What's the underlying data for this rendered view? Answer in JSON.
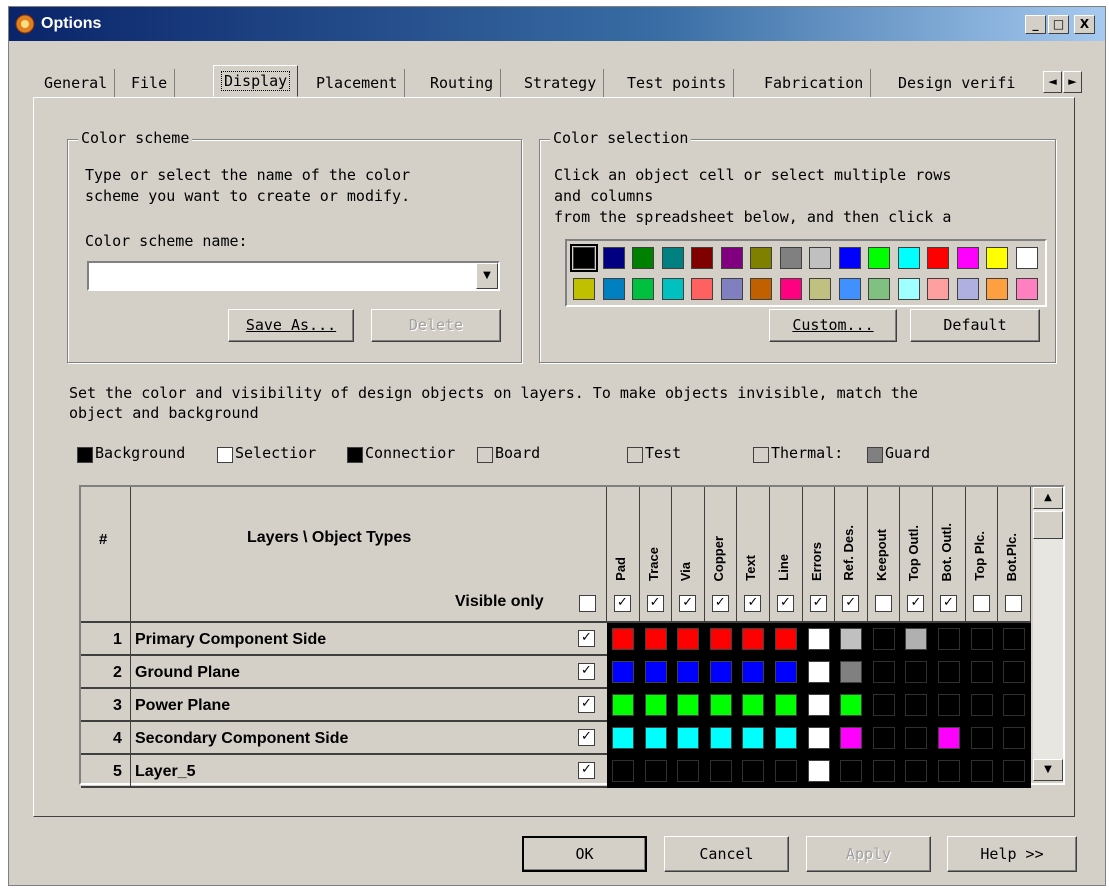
{
  "window": {
    "title": "Options",
    "title_icon": "app-icon",
    "minimize_glyph": "_",
    "maximize_glyph": "□",
    "close_glyph": "X"
  },
  "tabs": [
    {
      "label": "General",
      "active": false
    },
    {
      "label": "File",
      "active": false
    },
    {
      "label": "Display",
      "active": true
    },
    {
      "label": "Placement",
      "active": false
    },
    {
      "label": "Routing",
      "active": false
    },
    {
      "label": "Strategy",
      "active": false
    },
    {
      "label": "Test points",
      "active": false
    },
    {
      "label": "Fabrication",
      "active": false
    },
    {
      "label": "Design verifi",
      "active": false
    }
  ],
  "tab_scroll": {
    "left": "◄",
    "right": "►"
  },
  "color_scheme": {
    "legend": "Color scheme",
    "instructions_1": "Type or select the name of the color",
    "instructions_2": "scheme you want to create or modify.",
    "name_label": "Color scheme name:",
    "name_value": "",
    "save_as_label": "Save As...",
    "delete_label": "Delete"
  },
  "color_selection": {
    "legend": "Color selection",
    "instructions_1": "Click an object cell or select multiple rows",
    "instructions_2": "and columns",
    "instructions_3": "from the spreadsheet below, and then click a",
    "palette_row1": [
      "#000000",
      "#000080",
      "#008000",
      "#008080",
      "#800000",
      "#800080",
      "#808000",
      "#808080",
      "#c0c0c0",
      "#0000ff",
      "#00ff00",
      "#00ffff",
      "#ff0000",
      "#ff00ff",
      "#ffff00",
      "#ffffff"
    ],
    "palette_row2": [
      "#c0c000",
      "#0080c0",
      "#00c040",
      "#00c0c0",
      "#ff6060",
      "#8080c0",
      "#c06000",
      "#ff0080",
      "#c0c080",
      "#4090ff",
      "#80c080",
      "#a0ffff",
      "#ffa0a0",
      "#b0b0e0",
      "#ffa040",
      "#ff80c0"
    ],
    "selected_index": 0,
    "custom_label": "Custom...",
    "default_label": "Default"
  },
  "info_line_1": "Set the color and visibility of design objects on layers. To make objects invisible, match the",
  "info_line_2": "object and background",
  "legend_items": [
    {
      "label": "Background",
      "color": "#000000"
    },
    {
      "label": "Selectior",
      "color": "#ffffff"
    },
    {
      "label": "Connectior",
      "color": "#000000"
    },
    {
      "label": "Board",
      "color": "#d4d0c8"
    },
    {
      "label": "Test",
      "color": "#d4d0c8"
    },
    {
      "label": "Thermal:",
      "color": "#d4d0c8"
    },
    {
      "label": "Guard",
      "color": "#808080"
    }
  ],
  "grid": {
    "hash_header": "#",
    "layers_header": "Layers \\ Object Types",
    "visible_only_label": "Visible only",
    "visible_only_checked": false,
    "columns": [
      "Pad",
      "Trace",
      "Via",
      "Copper",
      "Text",
      "Line",
      "Errors",
      "Ref. Des.",
      "Keepout",
      "Top Outl.",
      "Bot. Outl.",
      "Top Plc.",
      "Bot.Plc."
    ],
    "column_visible": [
      true,
      true,
      true,
      true,
      true,
      true,
      true,
      true,
      false,
      true,
      true,
      false,
      false
    ],
    "rows": [
      {
        "num": "1",
        "name": "Primary Component Side",
        "visible": true,
        "colors": [
          "#ff0000",
          "#ff0000",
          "#ff0000",
          "#ff0000",
          "#ff0000",
          "#ff0000",
          "#ffffff",
          "#c0c0c0",
          "#000000",
          "#b0b0b0",
          "#000000",
          "#000000",
          "#000000"
        ]
      },
      {
        "num": "2",
        "name": "Ground Plane",
        "visible": true,
        "colors": [
          "#0000ff",
          "#0000ff",
          "#0000ff",
          "#0000ff",
          "#0000ff",
          "#0000ff",
          "#ffffff",
          "#808080",
          "#000000",
          "#000000",
          "#000000",
          "#000000",
          "#000000"
        ]
      },
      {
        "num": "3",
        "name": "Power Plane",
        "visible": true,
        "colors": [
          "#00ff00",
          "#00ff00",
          "#00ff00",
          "#00ff00",
          "#00ff00",
          "#00ff00",
          "#ffffff",
          "#00ff00",
          "#000000",
          "#000000",
          "#000000",
          "#000000",
          "#000000"
        ]
      },
      {
        "num": "4",
        "name": "Secondary Component Side",
        "visible": true,
        "colors": [
          "#00ffff",
          "#00ffff",
          "#00ffff",
          "#00ffff",
          "#00ffff",
          "#00ffff",
          "#ffffff",
          "#ff00ff",
          "#000000",
          "#000000",
          "#ff00ff",
          "#000000",
          "#000000"
        ]
      },
      {
        "num": "5",
        "name": "Layer_5",
        "visible": true,
        "colors": [
          "#000000",
          "#000000",
          "#000000",
          "#000000",
          "#000000",
          "#000000",
          "#ffffff",
          "#000000",
          "#000000",
          "#000000",
          "#000000",
          "#000000",
          "#000000"
        ]
      }
    ]
  },
  "footer": {
    "ok_label": "OK",
    "cancel_label": "Cancel",
    "apply_label": "Apply",
    "help_label": "Help >>"
  },
  "check_glyph": "✓",
  "scroll_up_glyph": "▲",
  "scroll_down_glyph": "▼",
  "combo_arrow_glyph": "▼"
}
